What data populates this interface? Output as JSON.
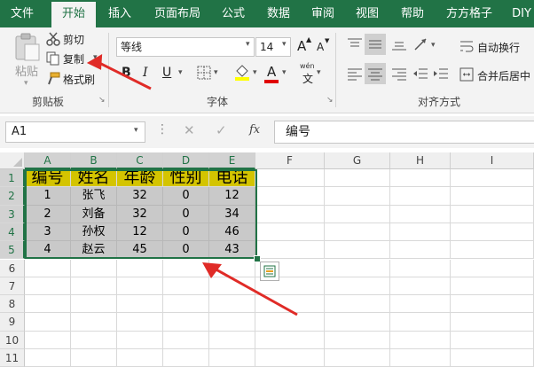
{
  "tabs": [
    "文件",
    "开始",
    "插入",
    "页面布局",
    "公式",
    "数据",
    "审阅",
    "视图",
    "帮助",
    "方方格子",
    "DIY"
  ],
  "clipboard": {
    "paste": "粘贴",
    "cut": "剪切",
    "copy": "复制",
    "format_painter": "格式刷",
    "group": "剪贴板"
  },
  "font": {
    "name": "等线",
    "size": "14",
    "grow": "A",
    "shrink": "A",
    "bold": "B",
    "italic": "I",
    "underline": "U",
    "font_color_letter": "A",
    "wen": "wén",
    "wen_char": "文",
    "group": "字体"
  },
  "alignment": {
    "wrap": "自动换行",
    "merge": "合并后居中",
    "group": "对齐方式"
  },
  "formula_bar": {
    "name_box": "A1",
    "fx": "fx",
    "value": "编号"
  },
  "columns": [
    "A",
    "B",
    "C",
    "D",
    "E",
    "F",
    "G",
    "H",
    "I"
  ],
  "rows": [
    "1",
    "2",
    "3",
    "4",
    "5",
    "6",
    "7",
    "8",
    "9",
    "10",
    "11"
  ],
  "table": {
    "header": [
      "编号",
      "姓名",
      "年龄",
      "性别",
      "电话"
    ],
    "data": [
      [
        "1",
        "张飞",
        "32",
        "0",
        "12"
      ],
      [
        "2",
        "刘备",
        "32",
        "0",
        "34"
      ],
      [
        "3",
        "孙权",
        "12",
        "0",
        "46"
      ],
      [
        "4",
        "赵云",
        "45",
        "0",
        "43"
      ]
    ]
  },
  "colors": {
    "excel_green": "#217346",
    "header_fill": "#d4c400",
    "selected_fill": "#c9c9c9",
    "arrow_red": "#e02b27"
  }
}
